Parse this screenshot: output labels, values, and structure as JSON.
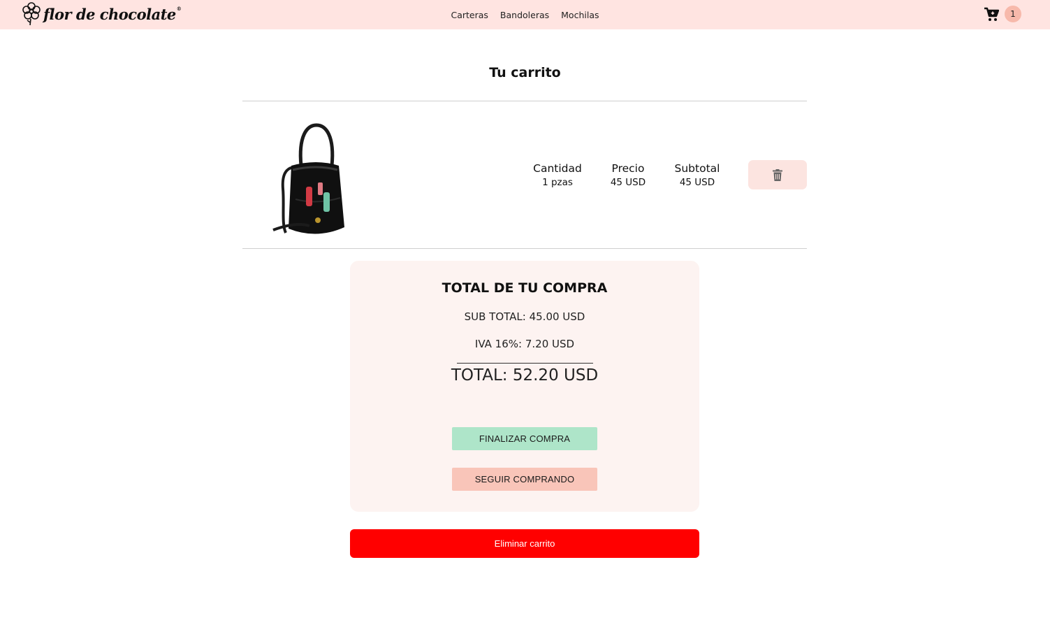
{
  "brand": {
    "name": "flor de chocolate",
    "reg_mark": "®"
  },
  "nav": {
    "links": [
      "Carteras",
      "Bandoleras",
      "Mochilas"
    ]
  },
  "cart": {
    "icon": "cart-icon",
    "count": "1"
  },
  "page": {
    "title": "Tu carrito"
  },
  "item": {
    "image_icon": "bucket-bag-image",
    "quantity_label": "Cantidad",
    "quantity_value": "1 pzas",
    "price_label": "Precio",
    "price_value": "45 USD",
    "subtotal_label": "Subtotal",
    "subtotal_value": "45 USD",
    "delete_icon": "trash-icon"
  },
  "summary": {
    "title": "TOTAL DE TU COMPRA",
    "subtotal": "SUB TOTAL: 45.00 USD",
    "iva": "IVA 16%: 7.20 USD",
    "total": "TOTAL: 52.20 USD",
    "finish_button": "FINALIZAR COMPRA",
    "continue_button": "SEGUIR COMPRANDO"
  },
  "clear_cart_button": "Eliminar carrito",
  "colors": {
    "navbar": "#ffe4e1",
    "badge": "#f7b9ab",
    "summary_bg": "#fdf3f1",
    "finish": "#aee5c9",
    "continue": "#f9c5b9",
    "danger": "#ff0000"
  }
}
